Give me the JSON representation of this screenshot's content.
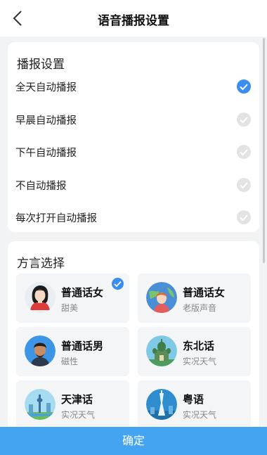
{
  "header": {
    "title": "语音播报设置"
  },
  "broadcast": {
    "title": "播报设置",
    "options": [
      {
        "label": "全天自动播报",
        "checked": true
      },
      {
        "label": "早晨自动播报",
        "checked": false
      },
      {
        "label": "下午自动播报",
        "checked": false
      },
      {
        "label": "不自动播报",
        "checked": false
      },
      {
        "label": "每次打开自动播报",
        "checked": false
      }
    ]
  },
  "dialect": {
    "title": "方言选择",
    "voices": [
      {
        "name": "普通话女",
        "desc": "甜美",
        "selected": true,
        "icon": "woman-avatar-icon"
      },
      {
        "name": "普通话女",
        "desc": "老版声音",
        "selected": false,
        "icon": "woman-globe-avatar-icon"
      },
      {
        "name": "普通话男",
        "desc": "磁性",
        "selected": false,
        "icon": "man-avatar-icon"
      },
      {
        "name": "东北话",
        "desc": "实况天气",
        "selected": false,
        "icon": "church-landmark-icon"
      },
      {
        "name": "天津话",
        "desc": "实况天气",
        "selected": false,
        "icon": "tower-landmark-icon"
      },
      {
        "name": "粤语",
        "desc": "实况天气",
        "selected": false,
        "icon": "canton-tower-icon"
      }
    ]
  },
  "footer": {
    "confirm_label": "确定"
  },
  "colors": {
    "accent": "#3a8ef0",
    "confirm_bg": "#44a4f2",
    "page_bg": "#f2f3f5"
  }
}
